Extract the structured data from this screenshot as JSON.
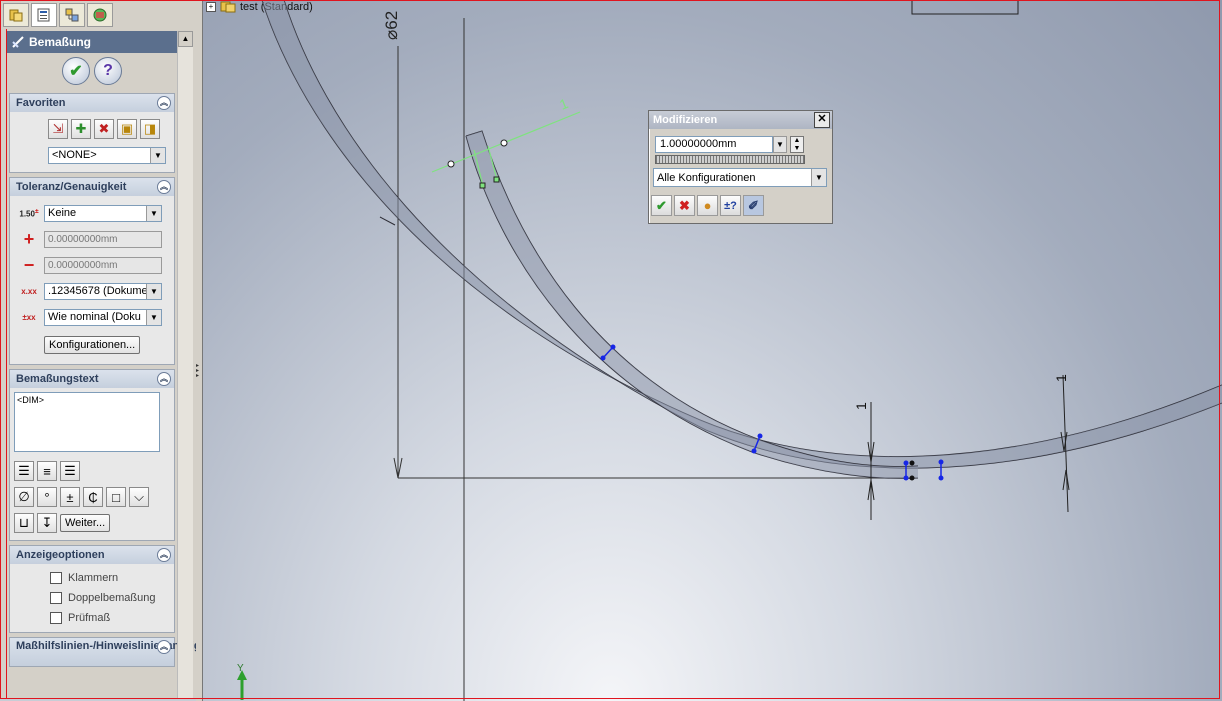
{
  "panel": {
    "tabs": [
      "feature-manager",
      "property-manager",
      "configuration-manager",
      "display-manager"
    ],
    "title": "Bemaßung",
    "ok_icon": "check-icon",
    "help_icon": "help-icon",
    "favorites": {
      "header": "Favoriten",
      "selected": "<NONE>"
    },
    "tolerance": {
      "header": "Toleranz/Genauigkeit",
      "type_icon_text": "1.50",
      "type": "Keine",
      "max_value": "0.00000000mm",
      "min_value": "0.00000000mm",
      "precision": ".12345678 (Dokume",
      "tol_precision": "Wie nominal (Doku",
      "config_button": "Konfigurationen..."
    },
    "dim_text": {
      "header": "Bemaßungstext",
      "value": "<DIM>",
      "more_button": "Weiter..."
    },
    "display": {
      "header": "Anzeigeoptionen",
      "options": [
        "Klammern",
        "Doppelbemaßung",
        "Prüfmaß"
      ]
    },
    "leaders": {
      "header": "Maßhilfslinien-/Hinweislinienanzeige"
    }
  },
  "tree": {
    "expander": "+",
    "label": "test  (Standard)"
  },
  "sketch": {
    "diameter_label": "⌀62",
    "dim_selected": "1",
    "dim_bottom_left": "1",
    "dim_bottom_right": "1",
    "axis_label": "Y"
  },
  "modify_dialog": {
    "title": "Modifizieren",
    "value": "1.00000000mm",
    "configuration": "Alle Konfigurationen",
    "close": "✕",
    "buttons": [
      "ok",
      "cancel",
      "rebuild",
      "reverse",
      "mark"
    ]
  },
  "colors": {
    "accent": "#e0141e",
    "selection": "#7fe37f",
    "point": "#1626e6",
    "title_bar": "#5b6f8d"
  }
}
